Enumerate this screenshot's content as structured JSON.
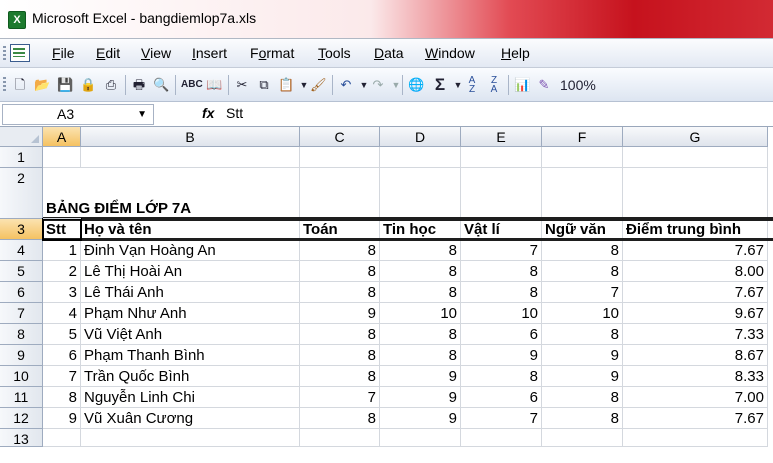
{
  "window": {
    "title": "Microsoft Excel - bangdiemlop7a.xls",
    "app_icon": "X"
  },
  "menu": [
    {
      "label": "File",
      "key": "F",
      "rest": "ile"
    },
    {
      "label": "Edit",
      "key": "E",
      "rest": "dit"
    },
    {
      "label": "View",
      "key": "V",
      "rest": "iew"
    },
    {
      "label": "Insert",
      "key": "I",
      "rest": "nsert"
    },
    {
      "label": "Format",
      "pre": "F",
      "key": "o",
      "rest": "rmat"
    },
    {
      "label": "Tools",
      "key": "T",
      "rest": "ools"
    },
    {
      "label": "Data",
      "key": "D",
      "rest": "ata"
    },
    {
      "label": "Window",
      "key": "W",
      "rest": "indow"
    },
    {
      "label": "Help",
      "key": "H",
      "rest": "elp"
    }
  ],
  "toolbar": {
    "zoom": "100%",
    "sigma": "Σ",
    "icons": [
      "new-icon",
      "open-icon",
      "save-icon",
      "permission-icon",
      "print-icon",
      "print-preview-icon",
      "spelling-icon",
      "research-icon",
      "cut-icon",
      "copy-icon",
      "paste-icon",
      "format-painter-icon",
      "undo-icon",
      "redo-icon",
      "hyperlink-icon",
      "autosum-icon",
      "sort-ascending-icon",
      "sort-descending-icon",
      "chart-wizard-icon",
      "drawing-icon"
    ]
  },
  "formula_bar": {
    "name_box": "A3",
    "fx": "fx",
    "content": "Stt"
  },
  "columns": [
    "A",
    "B",
    "C",
    "D",
    "E",
    "F",
    "G"
  ],
  "rows": [
    "1",
    "2",
    "3",
    "4",
    "5",
    "6",
    "7",
    "8",
    "9",
    "10",
    "11",
    "12",
    "13"
  ],
  "sheet": {
    "title": "BẢNG ĐIỂM LỚP 7A",
    "headers": [
      "Stt",
      "Họ và tên",
      "Toán",
      "Tin học",
      "Vật lí",
      "Ngữ văn",
      "Điểm trung bình"
    ],
    "records": [
      [
        "1",
        "Đinh Vạn Hoàng An",
        "8",
        "8",
        "7",
        "8",
        "7.67"
      ],
      [
        "2",
        "Lê Thị Hoài An",
        "8",
        "8",
        "8",
        "8",
        "8.00"
      ],
      [
        "3",
        "Lê Thái Anh",
        "8",
        "8",
        "8",
        "7",
        "7.67"
      ],
      [
        "4",
        "Phạm Như Anh",
        "9",
        "10",
        "10",
        "10",
        "9.67"
      ],
      [
        "5",
        "Vũ Việt Anh",
        "8",
        "8",
        "6",
        "8",
        "7.33"
      ],
      [
        "6",
        "Phạm Thanh Bình",
        "8",
        "8",
        "9",
        "9",
        "8.67"
      ],
      [
        "7",
        "Trần Quốc Bình",
        "8",
        "9",
        "8",
        "9",
        "8.33"
      ],
      [
        "8",
        "Nguyễn Linh Chi",
        "7",
        "9",
        "6",
        "8",
        "7.00"
      ],
      [
        "9",
        "Vũ Xuân Cương",
        "8",
        "9",
        "7",
        "8",
        "7.67"
      ]
    ]
  },
  "colors": {
    "title_bar_accent": "#c6121d",
    "active_header": "#f5c262",
    "excel_green": "#1d7a2e"
  }
}
